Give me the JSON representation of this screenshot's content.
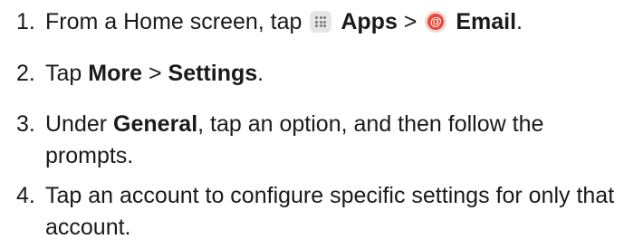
{
  "steps": [
    {
      "number": "1.",
      "parts": {
        "t1": "From a Home screen, tap",
        "b1": "Apps",
        "t2": ">",
        "b2": "Email",
        "t3": "."
      }
    },
    {
      "number": "2.",
      "parts": {
        "t1": "Tap",
        "b1": "More",
        "t2": ">",
        "b2": "Settings",
        "t3": "."
      }
    },
    {
      "number": "3.",
      "parts": {
        "t1": "Under",
        "b1": "General",
        "t2": ", tap an option, and then follow the prompts."
      }
    },
    {
      "number": "4.",
      "parts": {
        "t1": "Tap an account to configure specific settings for only that account."
      }
    }
  ],
  "icons": {
    "apps": "apps-grid-icon",
    "email": "email-at-icon",
    "email_glyph": "@"
  },
  "colors": {
    "email_red": "#e8473a",
    "text": "#1a1a1a"
  }
}
